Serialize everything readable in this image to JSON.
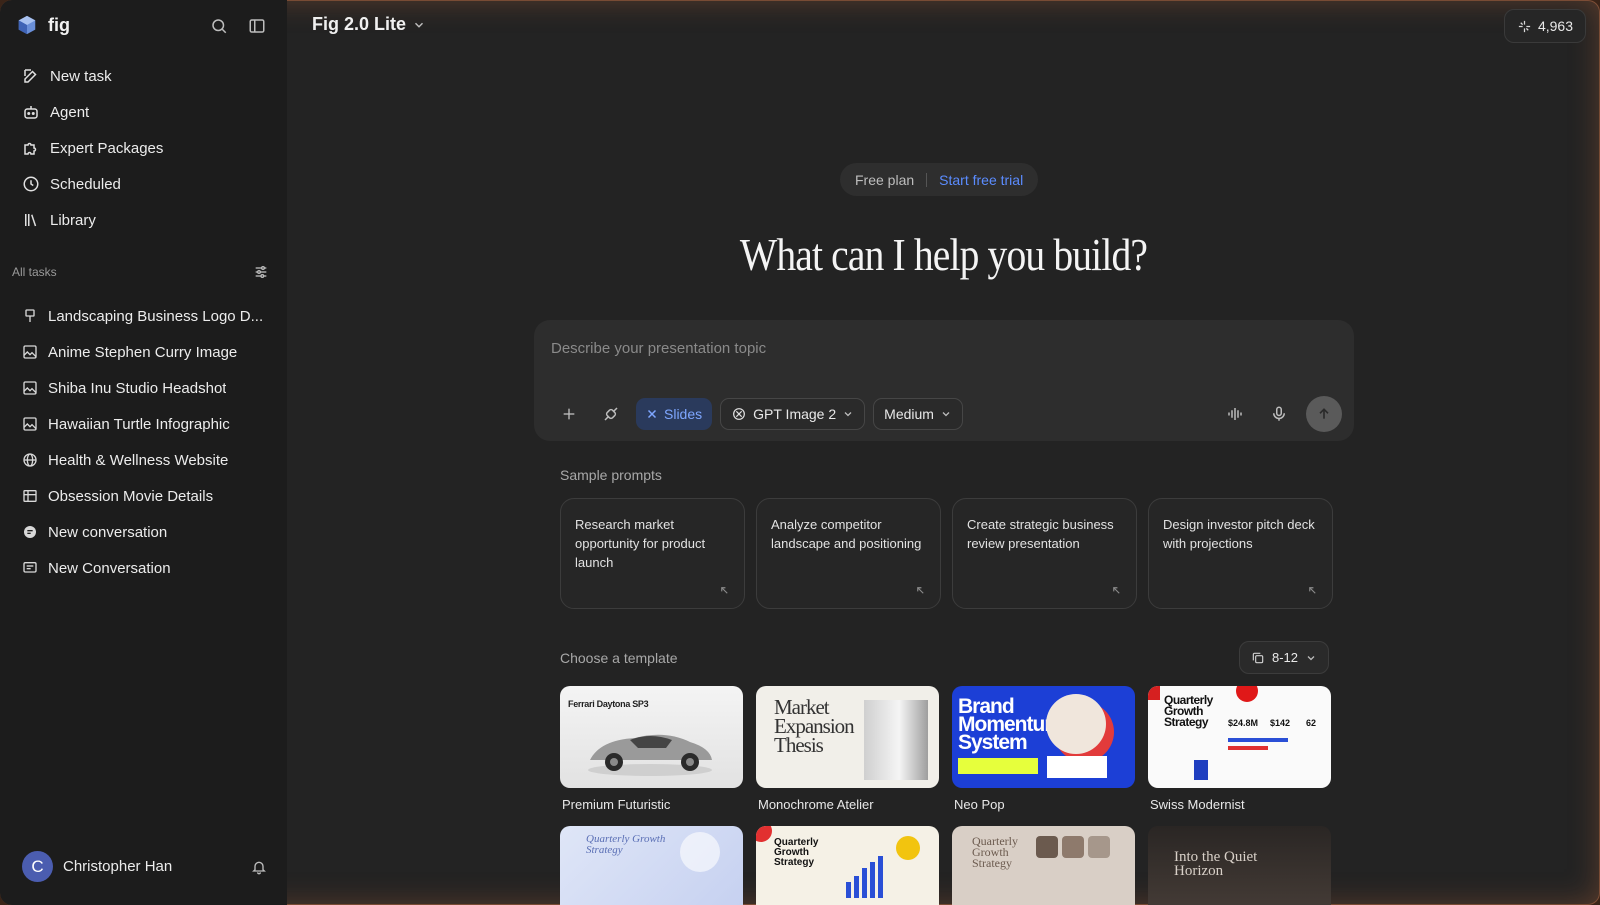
{
  "app": {
    "brand": "fig",
    "model": "Fig 2.0 Lite",
    "credits": "4,963"
  },
  "sidebar": {
    "nav": [
      {
        "label": "New task",
        "icon": "new-task-icon"
      },
      {
        "label": "Agent",
        "icon": "robot-icon"
      },
      {
        "label": "Expert Packages",
        "icon": "puzzle-icon"
      },
      {
        "label": "Scheduled",
        "icon": "clock-icon"
      },
      {
        "label": "Library",
        "icon": "library-icon"
      }
    ],
    "section_label": "All tasks",
    "tasks": [
      {
        "label": "Landscaping Business Logo D...",
        "icon": "brush-icon"
      },
      {
        "label": "Anime Stephen Curry Image",
        "icon": "image-icon"
      },
      {
        "label": "Shiba Inu Studio Headshot",
        "icon": "image-icon"
      },
      {
        "label": "Hawaiian Turtle Infographic",
        "icon": "image-icon"
      },
      {
        "label": "Health & Wellness Website",
        "icon": "globe-icon"
      },
      {
        "label": "Obsession Movie Details",
        "icon": "film-icon"
      },
      {
        "label": "New conversation",
        "icon": "chat-icon"
      },
      {
        "label": "New Conversation",
        "icon": "chat-icon"
      }
    ],
    "user": {
      "initial": "C",
      "name": "Christopher Han"
    }
  },
  "main": {
    "plan": {
      "free": "Free plan",
      "trial": "Start free trial"
    },
    "headline": "What can I help you build?",
    "composer": {
      "placeholder": "Describe your presentation topic",
      "mode_chip": "Slides",
      "image_model": "GPT Image 2",
      "quality": "Medium"
    },
    "sample_prompts_title": "Sample prompts",
    "sample_prompts": [
      "Research market opportunity for product launch",
      "Analyze competitor landscape and positioning",
      "Create strategic business review presentation",
      "Design investor pitch deck with projections"
    ],
    "templates_title": "Choose a template",
    "slide_count": "8-12",
    "templates": [
      {
        "label": "Premium Futuristic",
        "thumb_text": "Ferrari Daytona SP3"
      },
      {
        "label": "Monochrome Atelier",
        "thumb_text": "Market Expansion Thesis"
      },
      {
        "label": "Neo Pop",
        "thumb_text": "Brand Momentum System"
      },
      {
        "label": "Swiss Modernist",
        "thumb_text": "Quarterly Growth Strategy"
      },
      {
        "label": "",
        "thumb_text": "Quarterly Growth Strategy"
      },
      {
        "label": "",
        "thumb_text": "Quarterly Growth Strategy"
      },
      {
        "label": "",
        "thumb_text": "Quarterly Growth Strategy"
      },
      {
        "label": "",
        "thumb_text": "Into the Quiet Horizon"
      }
    ],
    "swiss_stats": [
      "$24.8M",
      "$142",
      "62"
    ]
  },
  "colors": {
    "accent": "#5b8cff",
    "slides_chip_bg": "#2a3a5c",
    "sidebar_bg": "#1c1c1c",
    "main_bg": "#232323"
  }
}
